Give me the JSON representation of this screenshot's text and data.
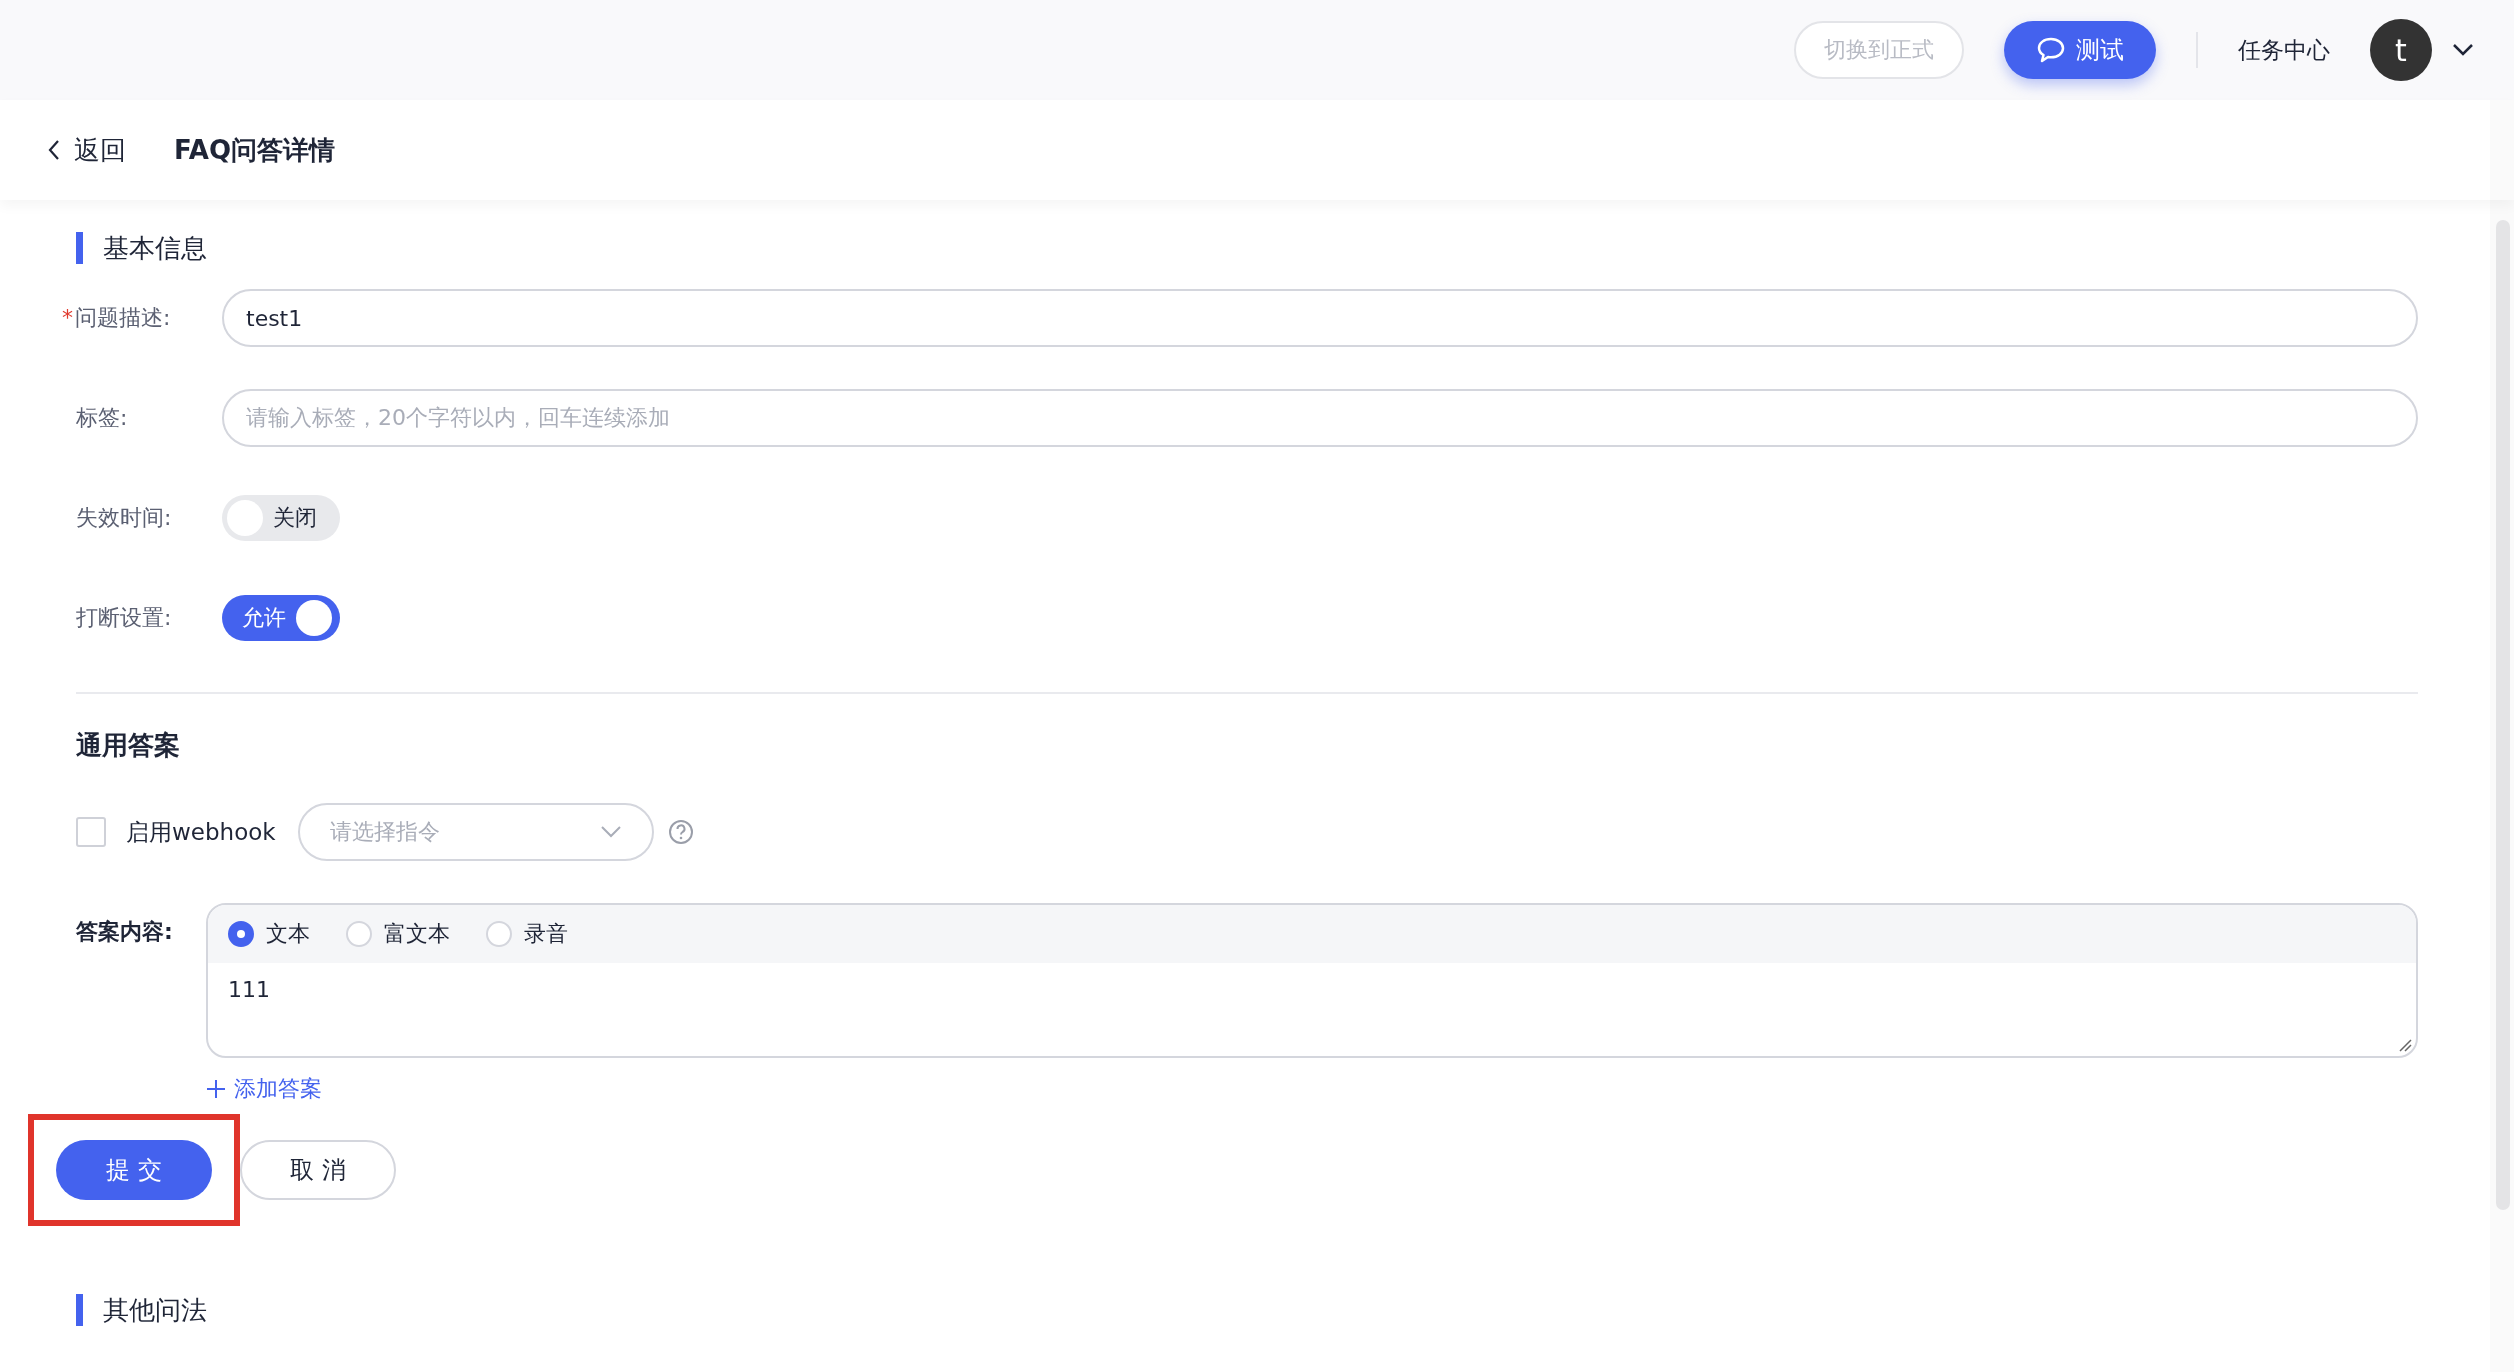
{
  "top_bar": {
    "switch_button": "切换到正式",
    "test_button": "测试",
    "task_center": "任务中心",
    "avatar": "t"
  },
  "header": {
    "back": "返回",
    "title": "FAQ问答详情"
  },
  "basic_info": {
    "title": "基本信息",
    "fields": [
      {
        "kind": "input",
        "label": "问题描述:",
        "required_mark": "*",
        "value": "test1"
      },
      {
        "kind": "input",
        "label": "标签:",
        "placeholder": "请输入标签，20个字符以内，回车连续添加"
      },
      {
        "kind": "toggle",
        "label": "失效时间:",
        "on": false,
        "text": "关闭"
      },
      {
        "kind": "toggle",
        "label": "打断设置:",
        "on": true,
        "text": "允许"
      }
    ]
  },
  "answer_section": {
    "title": "通用答案",
    "webhook": {
      "label": "启用webhook",
      "checked": false,
      "select_placeholder": "请选择指令"
    },
    "content": {
      "label": "答案内容:",
      "types": [
        {
          "label": "文本",
          "selected": true
        },
        {
          "label": "富文本",
          "selected": false
        },
        {
          "label": "录音",
          "selected": false
        }
      ],
      "value": "111"
    },
    "add_answer": "添加答案"
  },
  "actions": [
    {
      "kind": "primary",
      "label": "提 交",
      "highlighted": true
    },
    {
      "kind": "default",
      "label": "取 消",
      "highlighted": false
    }
  ],
  "other_section": {
    "title": "其他问法"
  }
}
